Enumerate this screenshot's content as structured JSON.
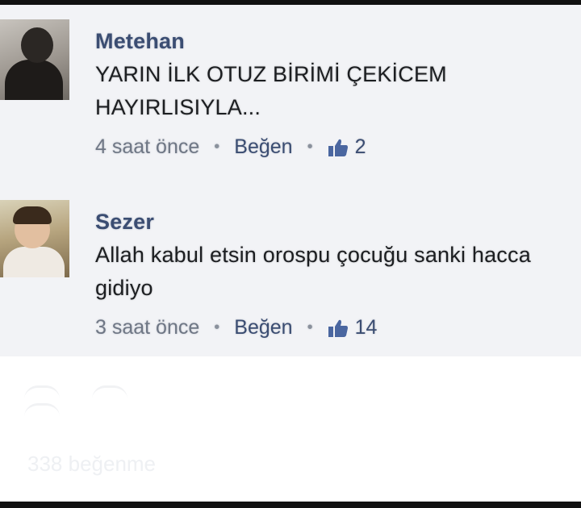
{
  "comments": [
    {
      "author": "Metehan",
      "text": "YARIN İLK OTUZ BİRİMİ ÇEKİCEM HAYIRLISIYLA...",
      "time": "4 saat önce",
      "like_label": "Beğen",
      "like_count": "2"
    },
    {
      "author": "Sezer",
      "text": "Allah kabul etsin orospu çocuğu sanki hacca gidiyo",
      "time": "3 saat önce",
      "like_label": "Beğen",
      "like_count": "14"
    }
  ],
  "post_footer": {
    "likes_text": "338 beğenme"
  },
  "colors": {
    "author": "#3b4d72",
    "meta": "#6f7785",
    "feed_background": "#f2f3f6",
    "frame": "#111111"
  },
  "icons": {
    "like": "thumbs-up-icon",
    "separator": "dot-separator"
  }
}
